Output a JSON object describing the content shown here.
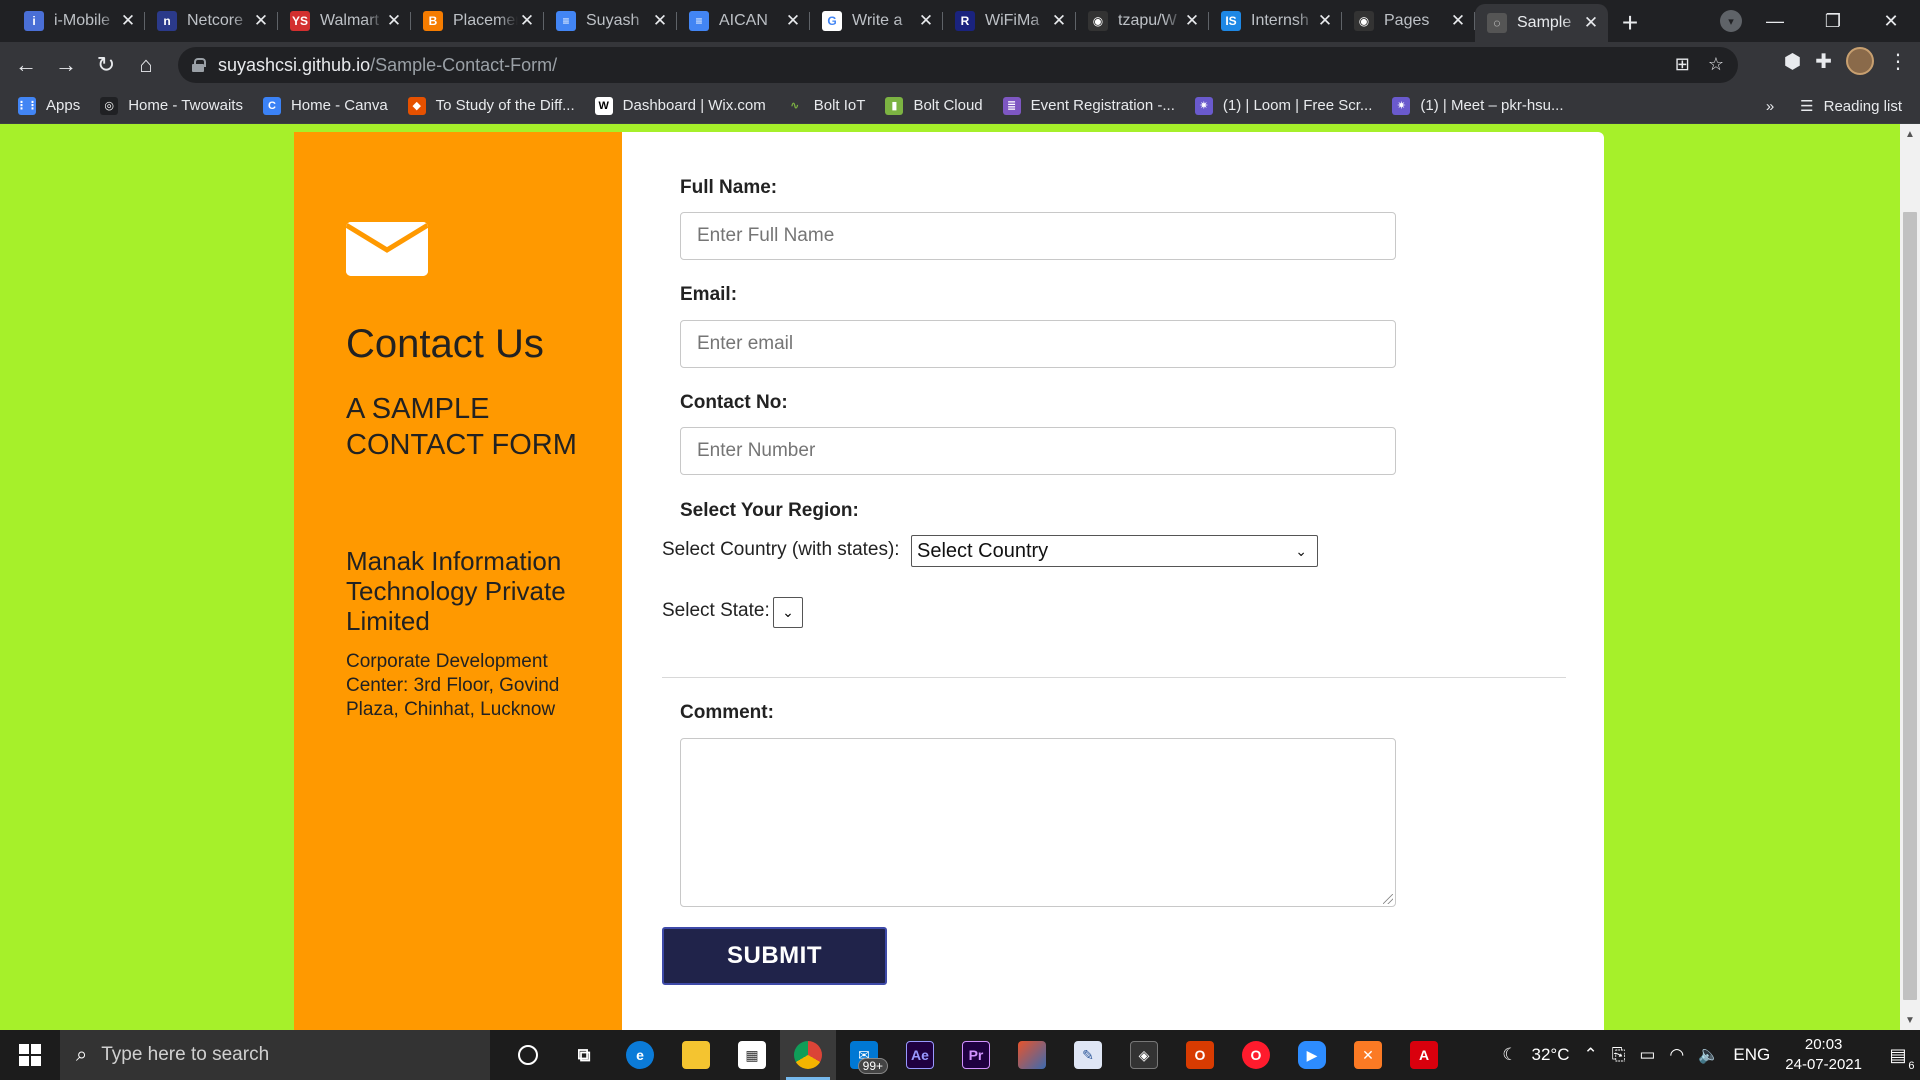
{
  "browser": {
    "tabs": [
      {
        "label": "i-Mobile",
        "color": "#4a6fd6",
        "glyph": "i"
      },
      {
        "label": "Netcore",
        "color": "#2b3a8a",
        "glyph": "n"
      },
      {
        "label": "Walmart",
        "color": "#d32f2f",
        "glyph": "YS"
      },
      {
        "label": "Placement",
        "color": "#f57c00",
        "glyph": "B"
      },
      {
        "label": "Suyash",
        "color": "#4285f4",
        "glyph": "≡"
      },
      {
        "label": "AICAN",
        "color": "#4285f4",
        "glyph": "≡"
      },
      {
        "label": "Write a",
        "color": "#ffffff",
        "glyph": "G"
      },
      {
        "label": "WiFiMa",
        "color": "#1a237e",
        "glyph": "R"
      },
      {
        "label": "tzapu/W",
        "color": "#333333",
        "glyph": "◉"
      },
      {
        "label": "Internsh",
        "color": "#1e88e5",
        "glyph": "IS"
      },
      {
        "label": "Pages",
        "color": "#333333",
        "glyph": "◉"
      },
      {
        "label": "Sample",
        "color": "#555555",
        "glyph": "◌"
      }
    ],
    "url_host": "suyashcsi.github.io",
    "url_path": "/Sample-Contact-Form/",
    "bookmarks": [
      {
        "label": "Apps",
        "color": "#4285f4",
        "glyph": "⋮⋮"
      },
      {
        "label": "Home - Twowaits",
        "color": "#202124",
        "glyph": "◎"
      },
      {
        "label": "Home - Canva",
        "color": "#3b82f6",
        "glyph": "C"
      },
      {
        "label": "To Study of the Diff...",
        "color": "#e65100",
        "glyph": "◆"
      },
      {
        "label": "Dashboard | Wix.com",
        "color": "#ffffff",
        "glyph": "W"
      },
      {
        "label": "Bolt IoT",
        "color": "#35363a",
        "glyph": "∿"
      },
      {
        "label": "Bolt Cloud",
        "color": "#7cb342",
        "glyph": "▮"
      },
      {
        "label": "Event Registration -...",
        "color": "#7e57c2",
        "glyph": "≣"
      },
      {
        "label": "(1) | Loom | Free Scr...",
        "color": "#6a5acd",
        "glyph": "✷"
      },
      {
        "label": "(1) | Meet – pkr-hsu...",
        "color": "#6a5acd",
        "glyph": "✷"
      }
    ],
    "reading_list": "Reading list",
    "more_bookmarks": "»"
  },
  "page": {
    "left": {
      "title": "Contact Us",
      "subtitle": "A SAMPLE CONTACT FORM",
      "company": "Manak Information Technology Private Limited",
      "address": "Corporate Development Center: 3rd Floor, Govind Plaza, Chinhat, Lucknow"
    },
    "form": {
      "full_name_label": "Full Name:",
      "full_name_placeholder": "Enter Full Name",
      "email_label": "Email:",
      "email_placeholder": "Enter email",
      "contact_label": "Contact No:",
      "contact_placeholder": "Enter Number",
      "region_label": "Select Your Region:",
      "country_label": "Select Country (with states):",
      "country_value": "Select Country",
      "state_label": "Select State:",
      "comment_label": "Comment:",
      "submit_label": "SUBMIT"
    },
    "colors": {
      "background": "#a6f02a",
      "left_panel": "#ff9900",
      "submit": "#20234a"
    }
  },
  "taskbar": {
    "search_placeholder": "Type here to search",
    "mail_badge": "99+",
    "temperature": "32°C",
    "language": "ENG",
    "time": "20:03",
    "date": "24-07-2021",
    "notifications": "6"
  }
}
